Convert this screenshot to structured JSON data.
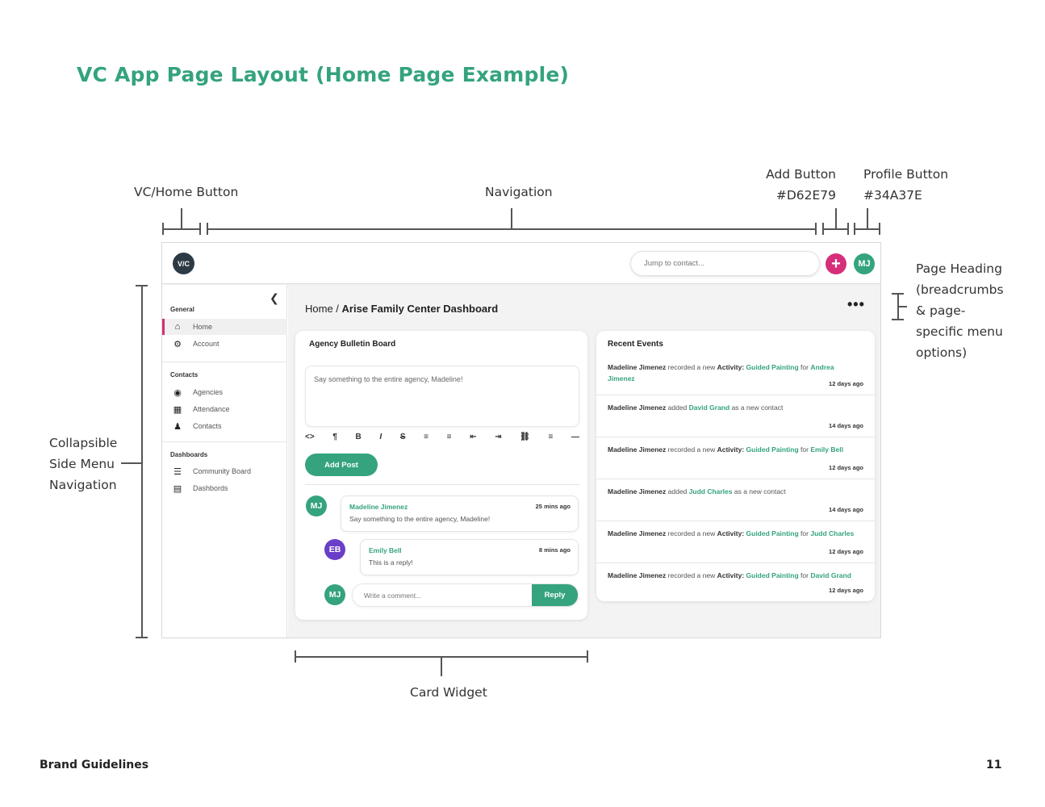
{
  "title": "VC App Page Layout (Home Page Example)",
  "annotations": {
    "home_button": "VC/Home Button",
    "navigation": "Navigation",
    "add_button_label": "Add Button",
    "add_button_color": "#D62E79",
    "profile_button_label": "Profile Button",
    "profile_button_color": "#34A37E",
    "page_heading": [
      "Page Heading",
      "(breadcrumbs",
      "& page-",
      "specific menu",
      "options)"
    ],
    "side_menu": [
      "Collapsible",
      "Side Menu",
      "Navigation"
    ],
    "card_widget": "Card Widget"
  },
  "topbar": {
    "logo_text": "V/C",
    "search_placeholder": "Jump to contact...",
    "add_symbol": "+",
    "profile_initials": "MJ"
  },
  "sidebar": {
    "collapse_icon": "chevron-left-icon",
    "sections": [
      {
        "title": "General",
        "items": [
          {
            "label": "Home",
            "icon": "home-icon"
          },
          {
            "label": "Account",
            "icon": "gears-icon"
          }
        ]
      },
      {
        "title": "Contacts",
        "items": [
          {
            "label": "Agencies",
            "icon": "agencies-icon"
          },
          {
            "label": "Attendance",
            "icon": "calendar-icon"
          },
          {
            "label": "Contacts",
            "icon": "person-icon"
          }
        ]
      },
      {
        "title": "Dashboards",
        "items": [
          {
            "label": "Community Board",
            "icon": "list-icon"
          },
          {
            "label": "Dashbords",
            "icon": "bar-chart-icon"
          }
        ]
      }
    ]
  },
  "page": {
    "crumb_home": "Home",
    "crumb_sep": " / ",
    "crumb_current": "Arise Family Center Dashboard",
    "menu_icon": "•••"
  },
  "bulletin": {
    "title": "Agency Bulletin Board",
    "post_placeholder": "Say something to the entire agency, Madeline!",
    "toolbar": [
      "<>",
      "¶",
      "B",
      "I",
      "S",
      "≡",
      "≡",
      "⇤",
      "⇥",
      "⛓",
      "≡",
      "—"
    ],
    "add_post": "Add Post",
    "posts": [
      {
        "initials": "MJ",
        "color": "#34A37E",
        "name": "Madeline Jimenez",
        "time": "25 mins ago",
        "text": "Say something to the entire agency, Madeline!"
      },
      {
        "initials": "EB",
        "color": "#6A3FC8",
        "name": "Emily Bell",
        "time": "8 mins ago",
        "text": "This is a reply!"
      }
    ],
    "comment_initials": "MJ",
    "comment_placeholder": "Write a comment...",
    "reply": "Reply"
  },
  "events": {
    "title": "Recent Events",
    "items": [
      {
        "actor": "Madeline Jimenez",
        "verb": " recorded a new ",
        "act": "Activity: ",
        "activity": "Guided Painting",
        "for": " for ",
        "target": "Andrea Jimenez",
        "suffix": "",
        "ago": "12 days ago"
      },
      {
        "actor": "Madeline Jimenez",
        "verb": " added ",
        "act": "",
        "activity": "",
        "for": "",
        "target": "David Grand",
        "suffix": " as a new contact",
        "ago": "14 days ago"
      },
      {
        "actor": "Madeline Jimenez",
        "verb": " recorded a new ",
        "act": "Activity: ",
        "activity": "Guided Painting",
        "for": " for ",
        "target": "Emily Bell",
        "suffix": "",
        "ago": "12 days ago"
      },
      {
        "actor": "Madeline Jimenez",
        "verb": " added ",
        "act": "",
        "activity": "",
        "for": "",
        "target": "Judd Charles",
        "suffix": " as a new contact",
        "ago": "14 days ago"
      },
      {
        "actor": "Madeline Jimenez",
        "verb": " recorded a new ",
        "act": "Activity: ",
        "activity": "Guided Painting",
        "for": " for ",
        "target": "Judd Charles",
        "suffix": "",
        "ago": "12 days ago"
      },
      {
        "actor": "Madeline Jimenez",
        "verb": " recorded a new ",
        "act": "Activity: ",
        "activity": "Guided Painting",
        "for": " for ",
        "target": "David Grand",
        "suffix": "",
        "ago": "12 days ago"
      }
    ]
  },
  "footer": {
    "left": "Brand Guidelines",
    "page": "11"
  }
}
